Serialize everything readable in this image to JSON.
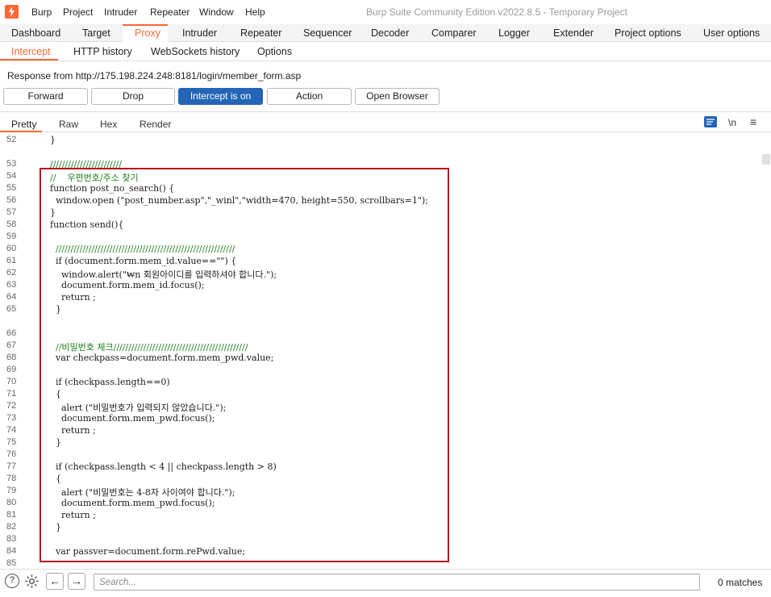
{
  "menu": [
    "Burp",
    "Project",
    "Intruder",
    "Repeater",
    "Window",
    "Help"
  ],
  "window_title": "Burp Suite Community Edition v2022.8.5 - Temporary Project",
  "main_tabs": [
    "Dashboard",
    "Target",
    "Proxy",
    "Intruder",
    "Repeater",
    "Sequencer",
    "Decoder",
    "Comparer",
    "Logger",
    "Extender",
    "Project options",
    "User options"
  ],
  "sub_tabs": [
    "Intercept",
    "HTTP history",
    "WebSockets history",
    "Options"
  ],
  "response_label": "Response from http://175.198.224.248:8181/login/member_form.asp",
  "buttons": {
    "forward": "Forward",
    "drop": "Drop",
    "intercept": "Intercept is on",
    "action": "Action",
    "open_browser": "Open Browser"
  },
  "view_tabs": [
    "Pretty",
    "Raw",
    "Hex",
    "Render"
  ],
  "view_icons": {
    "wrap": "wrap-lines-icon",
    "newline": "\\n",
    "menu": "≡"
  },
  "code_lines": [
    {
      "n": "52",
      "t": "}"
    },
    {
      "n": "53",
      "t": "////////////////////////"
    },
    {
      "n": "54",
      "t": "//    우편번호/주소 찾기"
    },
    {
      "n": "55",
      "t": "function post_no_search() {"
    },
    {
      "n": "56",
      "t": "  window.open (\"post_number.asp\",\"_winl\",\"width=470, height=550, scrollbars=1\");"
    },
    {
      "n": "57",
      "t": "}"
    },
    {
      "n": "58",
      "t": "function send(){"
    },
    {
      "n": "59",
      "t": ""
    },
    {
      "n": "60",
      "t": "  ////////////////////////////////////////////////////////////"
    },
    {
      "n": "61",
      "t": "  if (document.form.mem_id.value==\"\") {"
    },
    {
      "n": "62",
      "t": "    window.alert(\"₩n 회원아이디를 입력하셔야 합니다.\");"
    },
    {
      "n": "63",
      "t": "    document.form.mem_id.focus();"
    },
    {
      "n": "64",
      "t": "    return ;"
    },
    {
      "n": "65",
      "t": "  }"
    },
    {
      "n": "66",
      "t": ""
    },
    {
      "n": "67",
      "t": "  //비밀번호 체크/////////////////////////////////////////////"
    },
    {
      "n": "68",
      "t": "  var checkpass=document.form.mem_pwd.value;"
    },
    {
      "n": "69",
      "t": ""
    },
    {
      "n": "70",
      "t": "  if (checkpass.length==0)"
    },
    {
      "n": "71",
      "t": "  {"
    },
    {
      "n": "72",
      "t": "    alert (\"비밀번호가 입력되지 않았습니다.\");"
    },
    {
      "n": "73",
      "t": "    document.form.mem_pwd.focus();"
    },
    {
      "n": "74",
      "t": "    return ;"
    },
    {
      "n": "75",
      "t": "  }"
    },
    {
      "n": "76",
      "t": ""
    },
    {
      "n": "77",
      "t": "  if (checkpass.length < 4 || checkpass.length > 8)"
    },
    {
      "n": "78",
      "t": "  {"
    },
    {
      "n": "79",
      "t": "    alert (\"비밀번호는 4-8자 사이여야 합니다.\");"
    },
    {
      "n": "80",
      "t": "    document.form.mem_pwd.focus();"
    },
    {
      "n": "81",
      "t": "    return ;"
    },
    {
      "n": "82",
      "t": "  }"
    },
    {
      "n": "83",
      "t": ""
    },
    {
      "n": "84",
      "t": "  var passver=document.form.rePwd.value;"
    },
    {
      "n": "85",
      "t": ""
    }
  ],
  "search": {
    "placeholder": "Search..."
  },
  "matches": "0 matches",
  "colors": {
    "accent": "#ff6633",
    "primary_button": "#2465b8",
    "highlight_box": "#b80f1a"
  }
}
